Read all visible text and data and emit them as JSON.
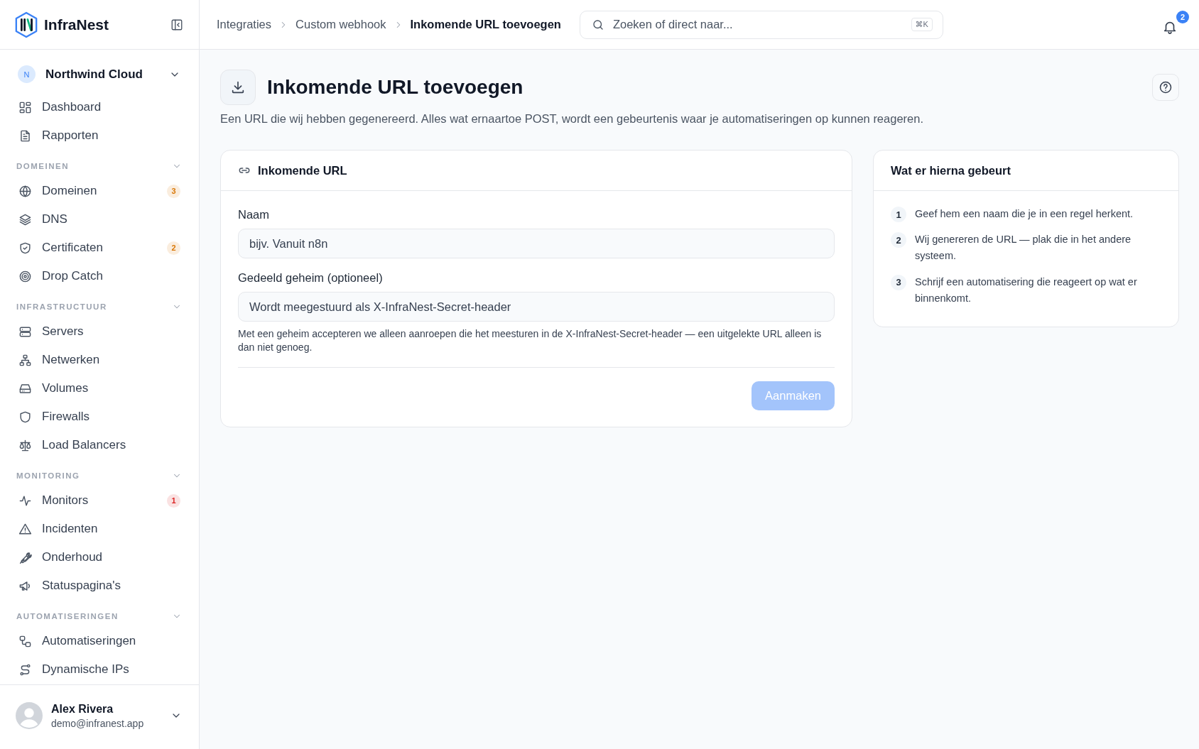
{
  "brand": {
    "name": "InfraNest"
  },
  "org": {
    "initial": "N",
    "name": "Northwind Cloud"
  },
  "nav_top": [
    {
      "label": "Dashboard"
    },
    {
      "label": "Rapporten"
    }
  ],
  "nav_sections": [
    {
      "title": "DOMEINEN",
      "expanded": true,
      "items": [
        {
          "label": "Domeinen",
          "badge": {
            "text": "3",
            "color": "#d97706"
          }
        },
        {
          "label": "DNS"
        },
        {
          "label": "Certificaten",
          "badge": {
            "text": "2",
            "color": "#d97706"
          }
        },
        {
          "label": "Drop Catch"
        }
      ]
    },
    {
      "title": "INFRASTRUCTUUR",
      "expanded": true,
      "items": [
        {
          "label": "Servers"
        },
        {
          "label": "Netwerken"
        },
        {
          "label": "Volumes"
        },
        {
          "label": "Firewalls"
        },
        {
          "label": "Load Balancers"
        }
      ]
    },
    {
      "title": "MONITORING",
      "expanded": true,
      "items": [
        {
          "label": "Monitors",
          "badge": {
            "text": "1",
            "color": "#dc2626"
          }
        },
        {
          "label": "Incidenten"
        },
        {
          "label": "Onderhoud"
        },
        {
          "label": "Statuspagina's"
        }
      ]
    },
    {
      "title": "AUTOMATISERINGEN",
      "expanded": true,
      "items": [
        {
          "label": "Automatiseringen"
        },
        {
          "label": "Dynamische IPs"
        }
      ]
    }
  ],
  "user": {
    "name": "Alex Rivera",
    "email": "demo@infranest.app"
  },
  "breadcrumbs": [
    "Integraties",
    "Custom webhook",
    "Inkomende URL toevoegen"
  ],
  "search": {
    "placeholder": "Zoeken of direct naar...",
    "shortcut": "⌘K"
  },
  "notifications": {
    "count": "2"
  },
  "page": {
    "title": "Inkomende URL toevoegen",
    "description": "Een URL die wij hebben gegenereerd. Alles wat ernaartoe POST, wordt een gebeurtenis waar je automatiseringen op kunnen reageren."
  },
  "form": {
    "title": "Inkomende URL",
    "fields": [
      {
        "label": "Naam",
        "placeholder": "bijv. Vanuit n8n"
      },
      {
        "label": "Gedeeld geheim (optioneel)",
        "placeholder": "Wordt meegestuurd als X-InfraNest-Secret-header",
        "help": "Met een geheim accepteren we alleen aanroepen die het meesturen in de X-InfraNest-Secret-header — een uitgelekte URL alleen is dan niet genoeg."
      }
    ],
    "submit": {
      "label": "Aanmaken",
      "disabled": true
    }
  },
  "steps_card": {
    "title": "Wat er hierna gebeurt",
    "steps": [
      {
        "number": "1",
        "text": "Geef hem een naam die je in een regel herkent."
      },
      {
        "number": "2",
        "text": "Wij genereren de URL — plak die in het andere systeem."
      },
      {
        "number": "3",
        "text": "Schrijf een automatisering die reageert op wat er binnenkomt."
      }
    ]
  }
}
